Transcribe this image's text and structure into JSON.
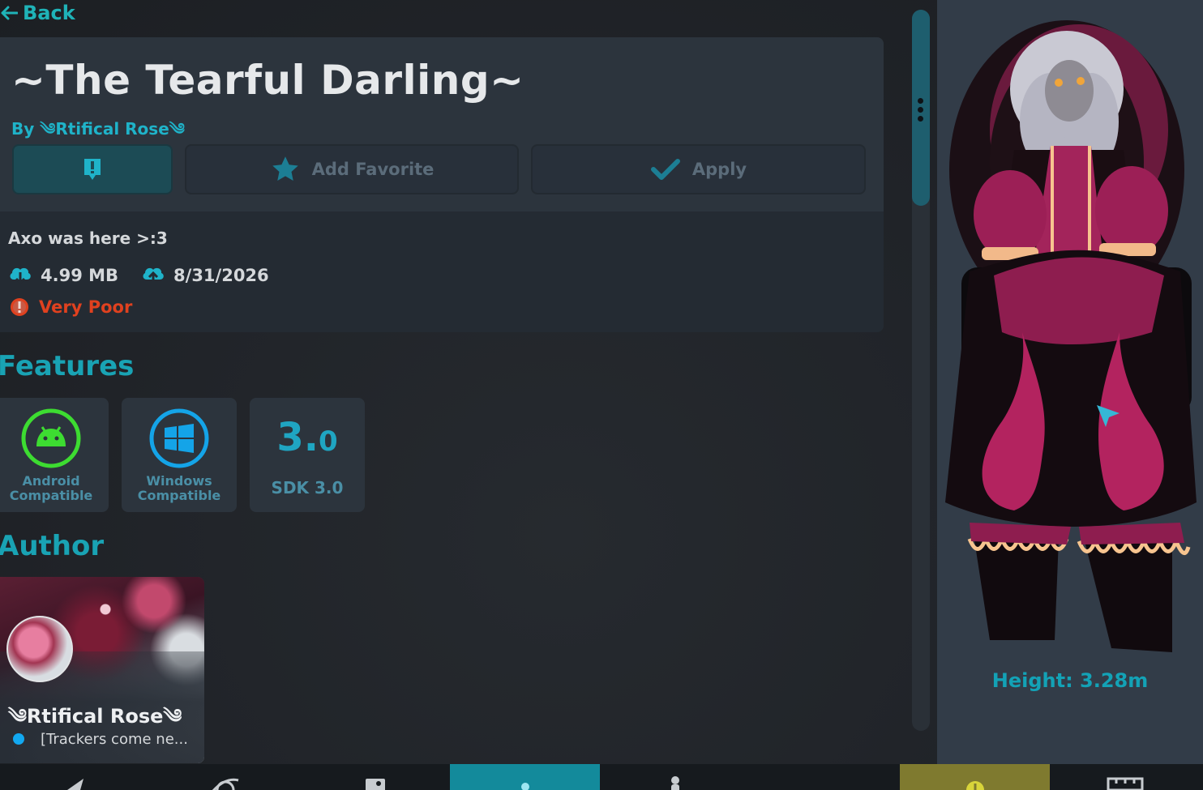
{
  "back": {
    "label": "Back"
  },
  "avatar": {
    "title": "~The Tearful Darling~",
    "byline": "By ༄Rtifical Rose༄",
    "description": "Axo was here >:3",
    "file_size": "4.99 MB",
    "updated_date": "8/31/2026",
    "performance": "Very Poor"
  },
  "actions": {
    "favorite_label": "Add Favorite",
    "apply_label": "Apply"
  },
  "features": {
    "title": "Features",
    "items": [
      {
        "label": "Android Compatible",
        "icon": "android-icon"
      },
      {
        "label": "Windows Compatible",
        "icon": "windows-icon"
      },
      {
        "big": "3.",
        "big_small": "0",
        "label": "SDK 3.0",
        "icon": "sdk-version"
      }
    ]
  },
  "author": {
    "title": "Author",
    "name": "༄Rtifical Rose༄",
    "status": "[Trackers come ne..."
  },
  "preview": {
    "height_label": "Height: 3.28m"
  },
  "colors": {
    "accent": "#19a3b4",
    "danger": "#e0411f",
    "online": "#12a8f0",
    "android": "#3ddc31",
    "windows": "#14a4e8"
  }
}
